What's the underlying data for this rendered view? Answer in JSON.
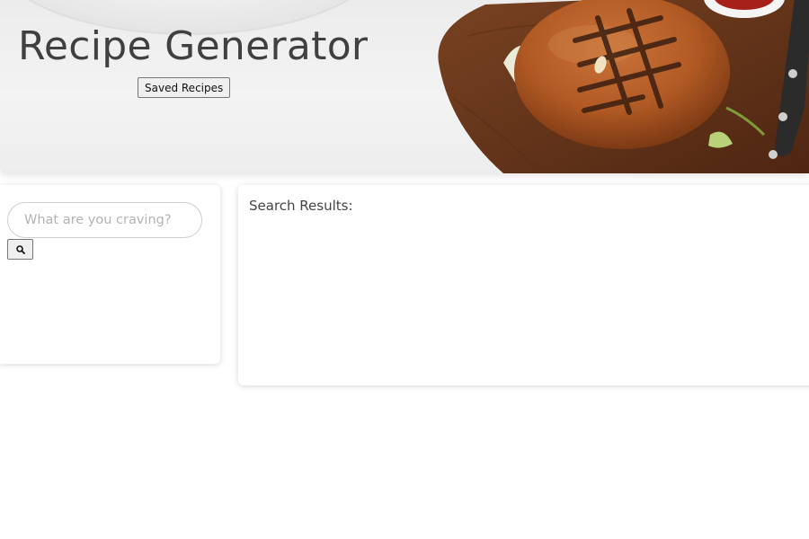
{
  "header": {
    "title": "Recipe Generator",
    "saved_recipes_label": "Saved Recipes"
  },
  "search": {
    "placeholder": "What are you craving?",
    "value": "",
    "button_icon": "search-icon"
  },
  "results": {
    "heading": "Search Results:"
  },
  "colors": {
    "title_text": "#404040",
    "card_background": "#ffffff",
    "hero_background": "#eeeeee",
    "burger_bun": "#b8602a",
    "cutting_board": "#6b3a1e"
  }
}
